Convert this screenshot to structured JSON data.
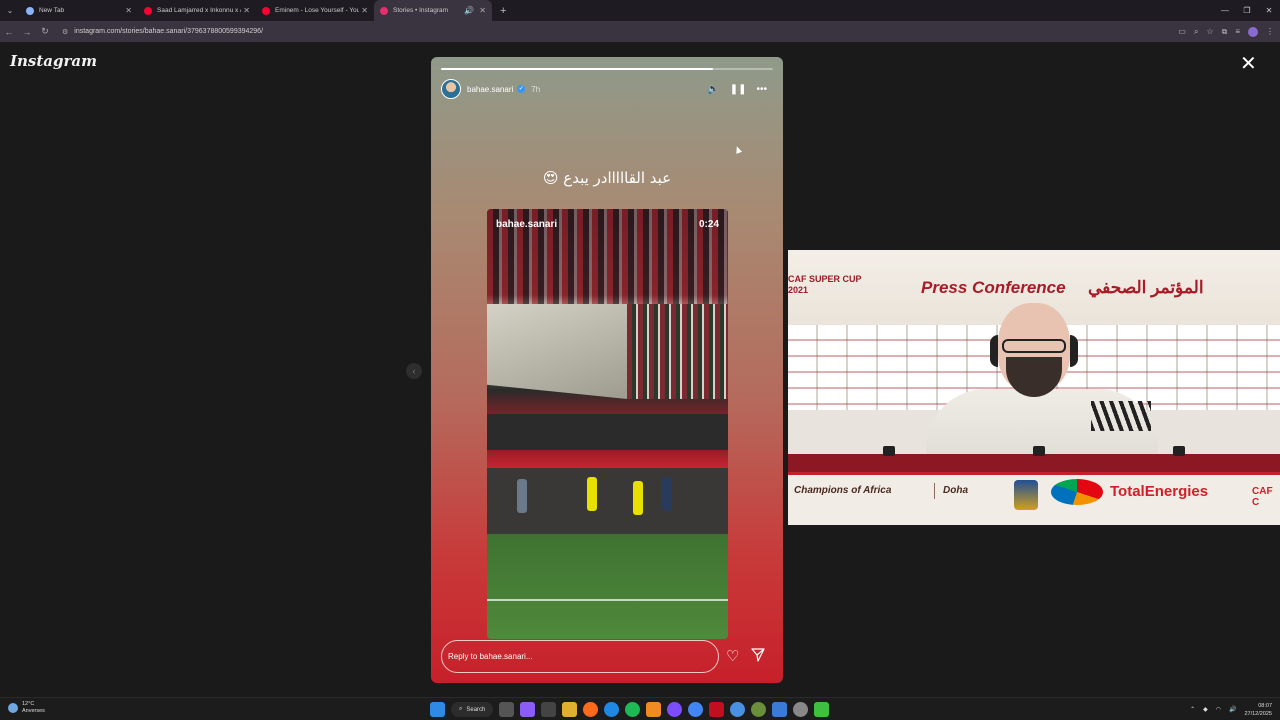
{
  "browser": {
    "tabs": [
      {
        "title": "New Tab",
        "color": "#8ab4f8",
        "active": false
      },
      {
        "title": "Saad Lamjarred x Inkonnu x Af...",
        "color": "#ff0033",
        "active": false
      },
      {
        "title": "Eminem - Lose Yourself - YouTu...",
        "color": "#ff0033",
        "active": false
      },
      {
        "title": "Stories • Instagram",
        "color": "#e1306c",
        "active": true
      }
    ],
    "new_tab_symbol": "+",
    "url": "instagram.com/stories/bahae.sanari/3796378800599394296/"
  },
  "instagram": {
    "logo": "Instagram",
    "close_symbol": "✕",
    "prev_symbol": "‹"
  },
  "story": {
    "progress": 0.82,
    "username": "bahae.sanari",
    "time": "7h",
    "caption": "عبد القااااادر يبدع 😍",
    "video_username": "bahae.sanari",
    "video_time": "0:24",
    "reply_placeholder": "Reply to bahae.sanari...",
    "heart_symbol": "♡"
  },
  "webcam": {
    "super_cup_line1": "CAF SUPER CUP",
    "super_cup_line2": "2021",
    "press_conference": "Press Conference",
    "arabic_title": "المؤتمر الصحفي",
    "champions": "Champions of Africa",
    "city": "Doha",
    "sponsor": "TotalEnergies",
    "caf_tail": "CAF C"
  },
  "taskbar": {
    "temperature": "12°C",
    "location": "Anverses",
    "search_label": "Search",
    "time": "08:07",
    "date": "27/12/2025"
  }
}
